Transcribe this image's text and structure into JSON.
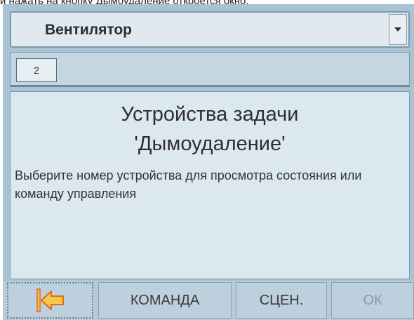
{
  "caption": "и нажать на кнопку Дымоудаление откроется окно.",
  "dropdown": {
    "selected": "Вентилятор"
  },
  "tabs": {
    "number": "2"
  },
  "panel": {
    "title_line1": "Устройства задачи",
    "title_line2": "'Дымоудаление'",
    "description": "Выберите номер устройства для просмотра состояния или команду управления"
  },
  "toolbar": {
    "back_icon": "arrow-left-icon",
    "command_label": "КОМАНДА",
    "scene_label": "СЦЕН.",
    "ok_label": "ОК"
  },
  "colors": {
    "device_bg": "#a8c3d4",
    "panel_bg": "#dce8ef",
    "icon_fill": "#f6c84a",
    "icon_stroke": "#e06a1a"
  }
}
